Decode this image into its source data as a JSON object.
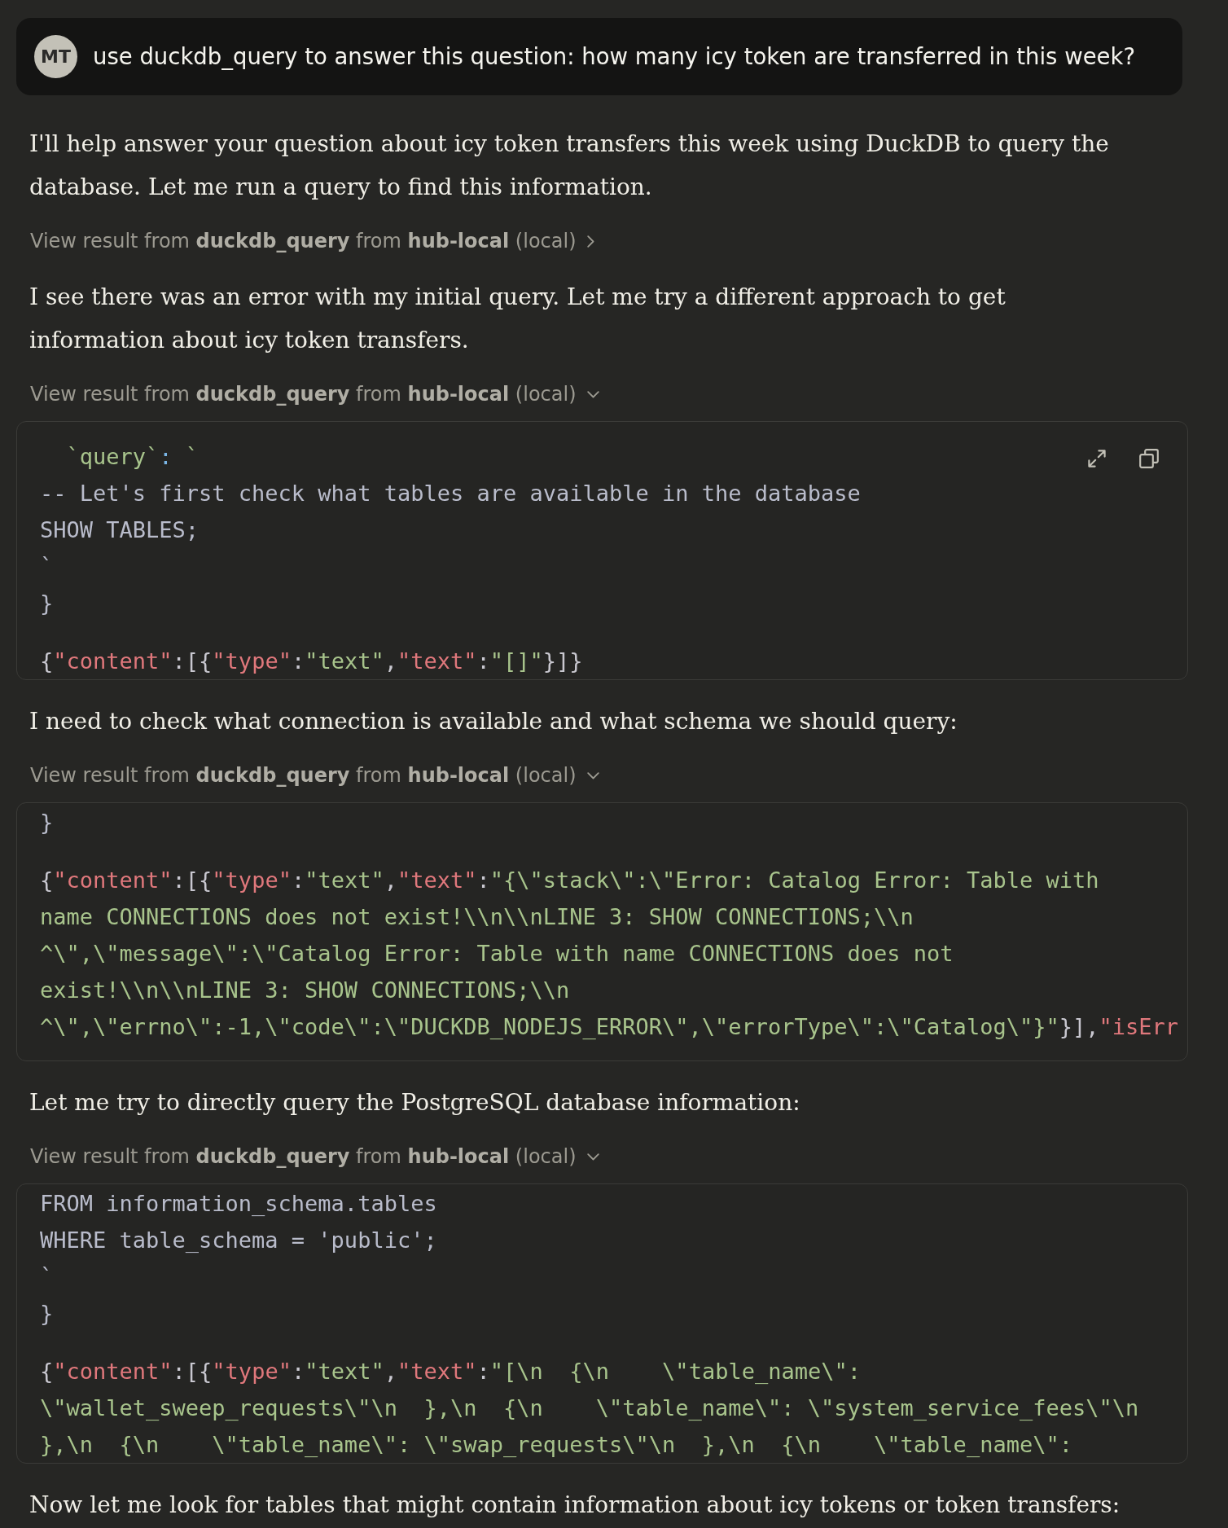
{
  "conversation": [
    {
      "kind": "user",
      "avatar": "MT",
      "text": "use duckdb_query to answer this question: how many icy token are transferred in this week?"
    },
    {
      "kind": "text",
      "text": "I'll help answer your question about icy token transfers this week using DuckDB to query the database. Let me run a query to find this information."
    },
    {
      "kind": "tool_result",
      "label": "View result from **duckdb_query** from **hub-local** (local)",
      "expanded": false
    },
    {
      "kind": "text",
      "text": "I see there was an error with my initial query. Let me try a different approach to get information about icy token transfers."
    },
    {
      "kind": "tool_result",
      "label": "View result from **duckdb_query** from **hub-local** (local)",
      "expanded": true,
      "hovered": true,
      "input": [
        [
          {
            "kind": "string",
            "text": "  `query`"
          },
          {
            "kind": "operator",
            "text": ":"
          },
          {
            "kind": "string",
            "text": " `"
          }
        ],
        [
          {
            "kind": "plain",
            "text": "-- Let's first check what tables are available in the database"
          }
        ],
        [
          {
            "kind": "plain",
            "text": "SHOW TABLES;"
          }
        ],
        [
          {
            "kind": "plain",
            "text": "`"
          }
        ],
        [
          {
            "kind": "plain",
            "text": "}"
          }
        ]
      ],
      "output": [
        [
          {
            "kind": "punct",
            "text": "{"
          },
          {
            "kind": "key",
            "text": "\"content\""
          },
          {
            "kind": "punct",
            "text": ":[{"
          },
          {
            "kind": "key",
            "text": "\"type\""
          },
          {
            "kind": "punct",
            "text": ":"
          },
          {
            "kind": "string",
            "text": "\"text\""
          },
          {
            "kind": "punct",
            "text": ","
          },
          {
            "kind": "key",
            "text": "\"text\""
          },
          {
            "kind": "punct",
            "text": ":"
          },
          {
            "kind": "string",
            "text": "\"[]\""
          },
          {
            "kind": "punct",
            "text": "}]}"
          }
        ]
      ]
    },
    {
      "kind": "text",
      "text": "I need to check what connection is available and what schema we should query:"
    },
    {
      "kind": "tool_result",
      "label": "View result from **duckdb_query** from **hub-local** (local)",
      "expanded": true,
      "hovered": false,
      "input": [
        [
          {
            "kind": "plain",
            "text": "}"
          }
        ]
      ],
      "output": [
        [
          {
            "kind": "punct",
            "text": "{"
          },
          {
            "kind": "key",
            "text": "\"content\""
          },
          {
            "kind": "punct",
            "text": ":[{"
          },
          {
            "kind": "key",
            "text": "\"type\""
          },
          {
            "kind": "punct",
            "text": ":"
          },
          {
            "kind": "string",
            "text": "\"text\""
          },
          {
            "kind": "punct",
            "text": ","
          },
          {
            "kind": "key",
            "text": "\"text\""
          },
          {
            "kind": "punct",
            "text": ":"
          },
          {
            "kind": "string",
            "text": "\"{\\\"stack\\\":\\\"Error: Catalog Error: Table with"
          }
        ],
        [
          {
            "kind": "string",
            "text": "name CONNECTIONS does not exist!\\\\n\\\\nLINE 3: SHOW CONNECTIONS;\\\\n"
          }
        ],
        [
          {
            "kind": "string",
            "text": "^\\\",\\\"message\\\":\\\"Catalog Error: Table with name CONNECTIONS does not"
          }
        ],
        [
          {
            "kind": "string",
            "text": "exist!\\\\n\\\\nLINE 3: SHOW CONNECTIONS;\\\\n"
          }
        ],
        [
          {
            "kind": "string",
            "text": "^\\\",\\\"errno\\\":-1,\\\"code\\\":\\\"DUCKDB_NODEJS_ERROR\\\",\\\"errorType\\\":\\\"Catalog\\\"}\""
          },
          {
            "kind": "punct",
            "text": "}],"
          },
          {
            "kind": "key",
            "text": "\"isErr"
          }
        ]
      ]
    },
    {
      "kind": "text",
      "text": "Let me try to directly query the PostgreSQL database information:"
    },
    {
      "kind": "tool_result",
      "label": "View result from **duckdb_query** from **hub-local** (local)",
      "expanded": true,
      "hovered": false,
      "input": [
        [
          {
            "kind": "plain",
            "text": "FROM information_schema.tables"
          }
        ],
        [
          {
            "kind": "plain",
            "text": "WHERE table_schema = 'public';"
          }
        ],
        [
          {
            "kind": "plain",
            "text": "`"
          }
        ],
        [
          {
            "kind": "plain",
            "text": "}"
          }
        ]
      ],
      "output": [
        [
          {
            "kind": "punct",
            "text": "{"
          },
          {
            "kind": "key",
            "text": "\"content\""
          },
          {
            "kind": "punct",
            "text": ":[{"
          },
          {
            "kind": "key",
            "text": "\"type\""
          },
          {
            "kind": "punct",
            "text": ":"
          },
          {
            "kind": "string",
            "text": "\"text\""
          },
          {
            "kind": "punct",
            "text": ","
          },
          {
            "kind": "key",
            "text": "\"text\""
          },
          {
            "kind": "punct",
            "text": ":"
          },
          {
            "kind": "string",
            "text": "\"[\\n  {\\n    \\\"table_name\\\":"
          }
        ],
        [
          {
            "kind": "string",
            "text": "\\\"wallet_sweep_requests\\\"\\n  },\\n  {\\n    \\\"table_name\\\": \\\"system_service_fees\\\"\\n"
          }
        ],
        [
          {
            "kind": "string",
            "text": "},\\n  {\\n    \\\"table_name\\\": \\\"swap_requests\\\"\\n  },\\n  {\\n    \\\"table_name\\\":"
          }
        ]
      ]
    },
    {
      "kind": "text",
      "text": "Now let me look for tables that might contain information about icy tokens or token transfers:"
    }
  ]
}
